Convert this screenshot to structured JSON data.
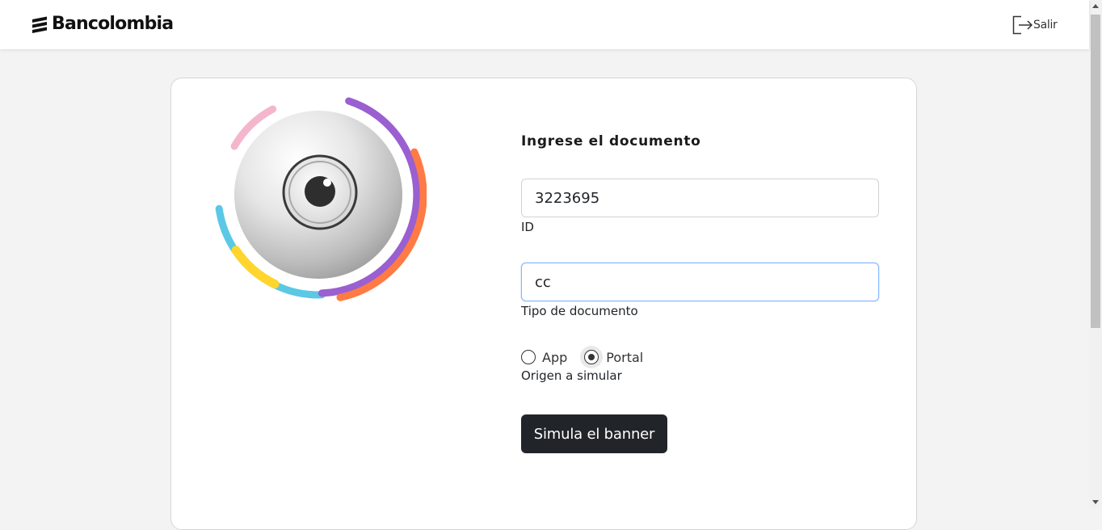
{
  "header": {
    "brand": "Bancolombia",
    "logout_label": "Salir"
  },
  "form": {
    "title": "Ingrese el documento",
    "id_field": {
      "value": "3223695",
      "label": "ID"
    },
    "doc_type_field": {
      "value": "cc",
      "label": "Tipo de documento"
    },
    "origin": {
      "label": "Origen a simular",
      "options": [
        {
          "label": "App",
          "checked": false
        },
        {
          "label": "Portal",
          "checked": true
        }
      ]
    },
    "submit_label": "Simula el banner"
  },
  "illustration": {
    "arc_colors": [
      "#f4b6cd",
      "#5bc8e6",
      "#ffd52e",
      "#9a5fd0",
      "#ff7a45"
    ]
  }
}
